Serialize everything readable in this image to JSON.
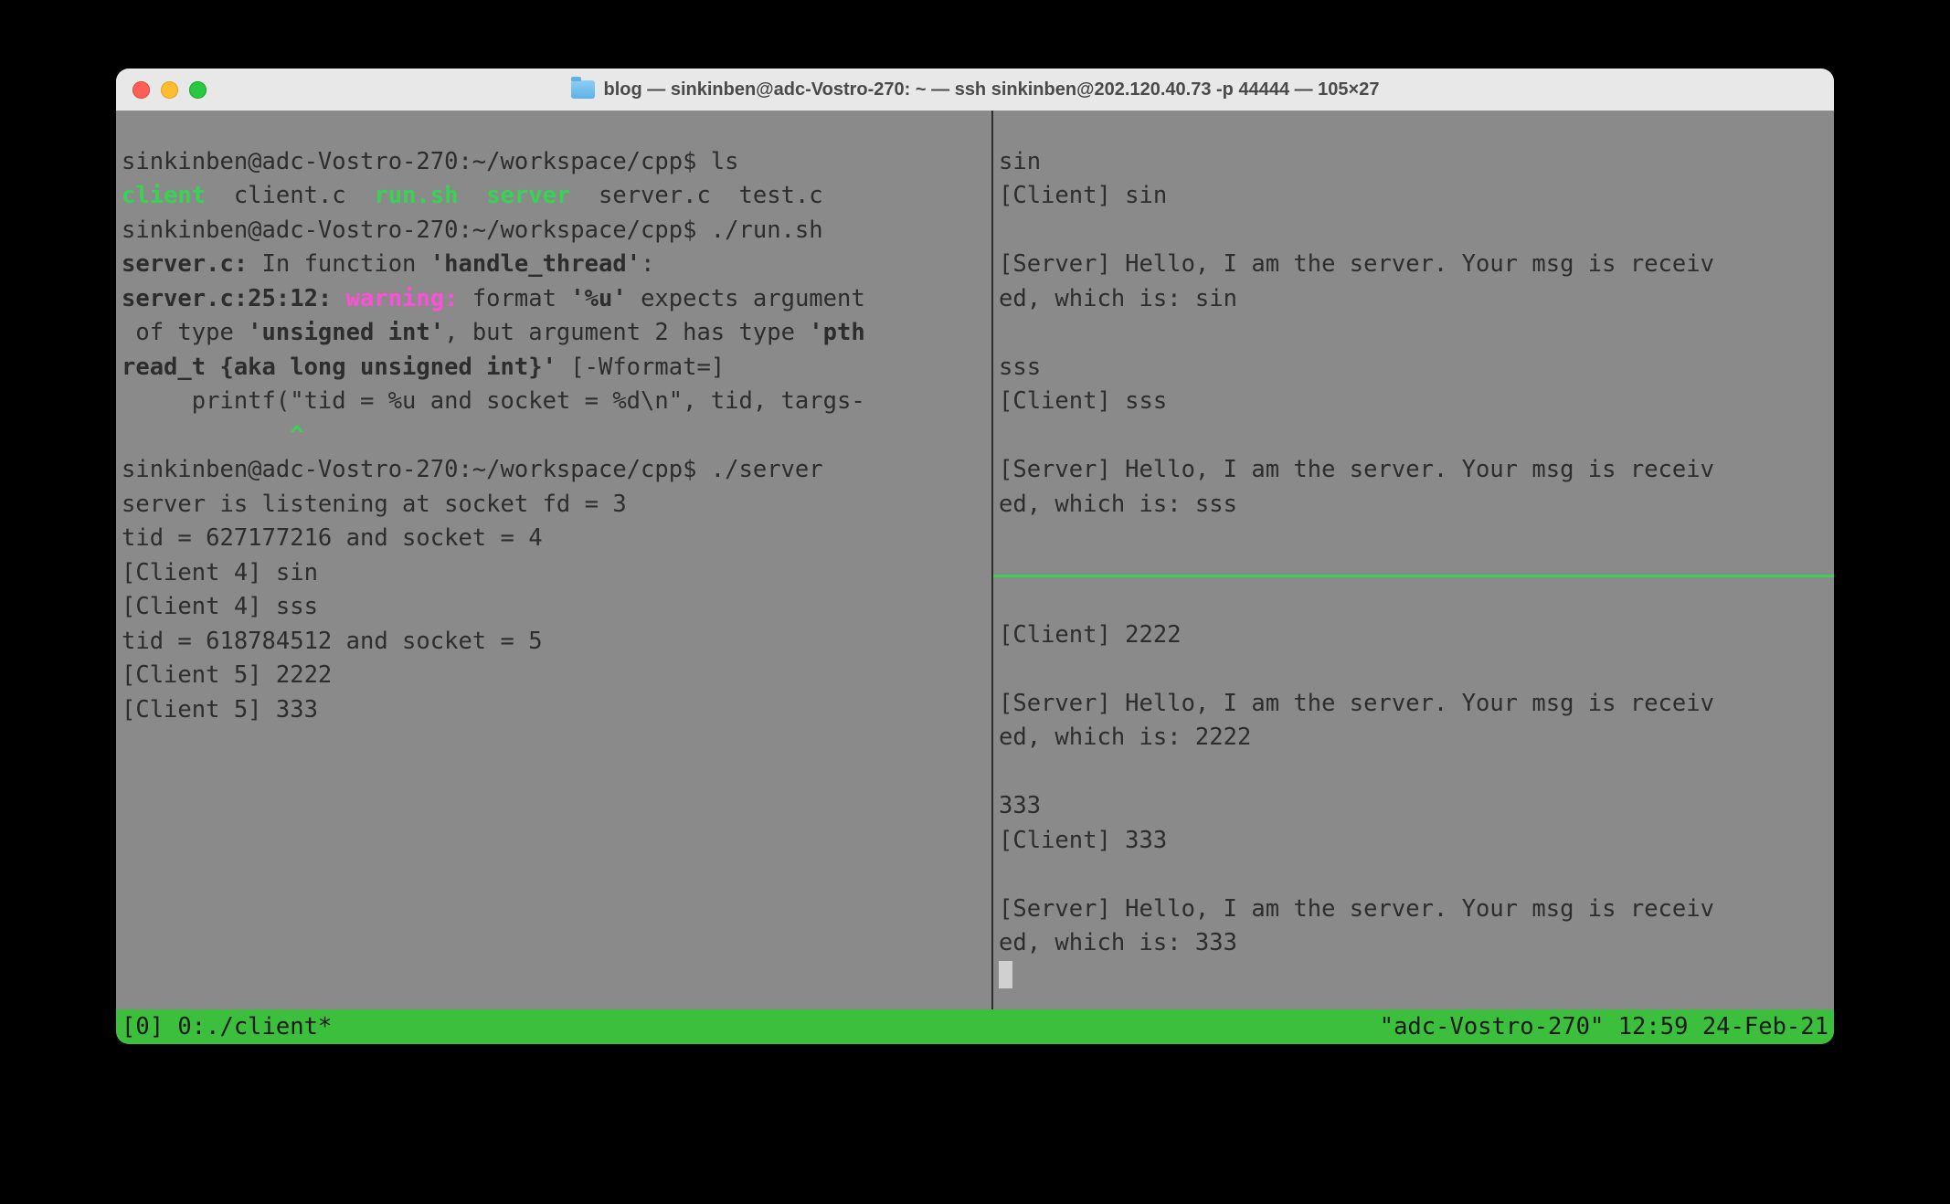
{
  "window": {
    "title": "blog — sinkinben@adc-Vostro-270: ~ — ssh sinkinben@202.120.40.73 -p 44444 — 105×27"
  },
  "left": {
    "prompt1": "sinkinben@adc-Vostro-270:~/workspace/cpp$ ls",
    "ls_client": "client",
    "ls_clientc": "  client.c  ",
    "ls_runsh": "run.sh",
    "ls_server": "  server",
    "ls_rest": "  server.c  test.c",
    "prompt2": "sinkinben@adc-Vostro-270:~/workspace/cpp$ ./run.sh",
    "warn1a": "server.c:",
    "warn1b": " In function ",
    "warn1c": "'handle_thread'",
    "warn1d": ":",
    "warn2a": "server.c:25:12: ",
    "warn2_w": "warning:",
    "warn2b": " format ",
    "warn2c": "'%u'",
    "warn2d": " expects argument",
    "warn3a": " of type ",
    "warn3b": "'unsigned int'",
    "warn3c": ", but argument 2 has type ",
    "warn3d": "'pth",
    "warn4a": "read_t {aka long unsigned int}'",
    "warn4b": " [-Wformat=]",
    "printf": "     printf(\"tid = %u and socket = %d\\n\", tid, targs-",
    "caret": "            ^",
    "prompt3": "sinkinben@adc-Vostro-270:~/workspace/cpp$ ./server",
    "line_listen": "server is listening at socket fd = 3",
    "line_tid1": "tid = 627177216 and socket = 4",
    "line_c4a": "[Client 4] sin",
    "line_c4b": "[Client 4] sss",
    "line_tid2": "tid = 618784512 and socket = 5",
    "line_c5a": "[Client 5] 2222",
    "line_c5b": "[Client 5] 333"
  },
  "right_top": {
    "l1": "sin",
    "l2": "[Client] sin",
    "l3": "",
    "l4": "[Server] Hello, I am the server. Your msg is receiv",
    "l5": "ed, which is: sin",
    "l6": "",
    "l7": "sss",
    "l8": "[Client] sss",
    "l9": "",
    "l10": "[Server] Hello, I am the server. Your msg is receiv",
    "l11": "ed, which is: sss"
  },
  "right_bot": {
    "l1": "[Client] 2222",
    "l2": "",
    "l3": "[Server] Hello, I am the server. Your msg is receiv",
    "l4": "ed, which is: 2222",
    "l5": "",
    "l6": "333",
    "l7": "[Client] 333",
    "l8": "",
    "l9": "[Server] Hello, I am the server. Your msg is receiv",
    "l10": "ed, which is: 333"
  },
  "status": {
    "left": "[0] 0:./client*",
    "right": "\"adc-Vostro-270\" 12:59 24-Feb-21"
  }
}
